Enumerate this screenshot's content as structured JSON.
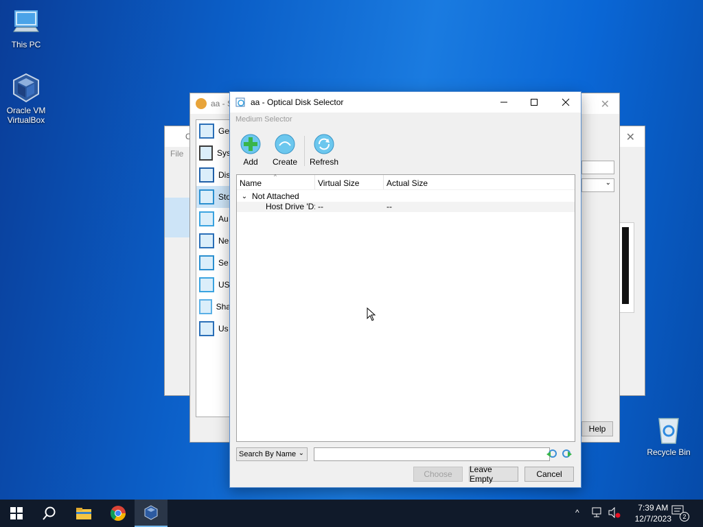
{
  "desktop": {
    "icons": [
      {
        "label": "This PC"
      },
      {
        "label": "Oracle VM\nVirtualBox"
      },
      {
        "label": "Recycle Bin"
      }
    ]
  },
  "background_windows": {
    "settings_title": "aa - S",
    "manager_title_char": "O",
    "manager_menu": "File",
    "help_button": "Help",
    "settings_sidebar": [
      "Ge",
      "Sys",
      "Dis",
      "Sto",
      "Au",
      "Ne",
      "Se",
      "US",
      "Sha",
      "Us"
    ]
  },
  "dialog": {
    "title": "aa - Optical Disk Selector",
    "section_label": "Medium Selector",
    "toolbar": [
      {
        "label": "Add",
        "icon": "add-disk-icon"
      },
      {
        "label": "Create",
        "icon": "create-disk-icon"
      },
      {
        "label": "Refresh",
        "icon": "refresh-icon"
      }
    ],
    "columns": [
      "Name",
      "Virtual Size",
      "Actual Size"
    ],
    "group": "Not Attached",
    "rows": [
      {
        "name": "Host Drive 'D:'",
        "virtual_size": "--",
        "actual_size": "--"
      }
    ],
    "search_mode": "Search By Name",
    "search_value": "",
    "buttons": {
      "choose": "Choose",
      "leave_empty": "Leave Empty",
      "cancel": "Cancel"
    }
  },
  "taskbar": {
    "time": "7:39 AM",
    "date": "12/7/2023",
    "notification_count": "2"
  },
  "colors": {
    "accent": "#0a67d6",
    "toolbar_icon": "#4fb4e6",
    "add_green": "#39b54a"
  }
}
